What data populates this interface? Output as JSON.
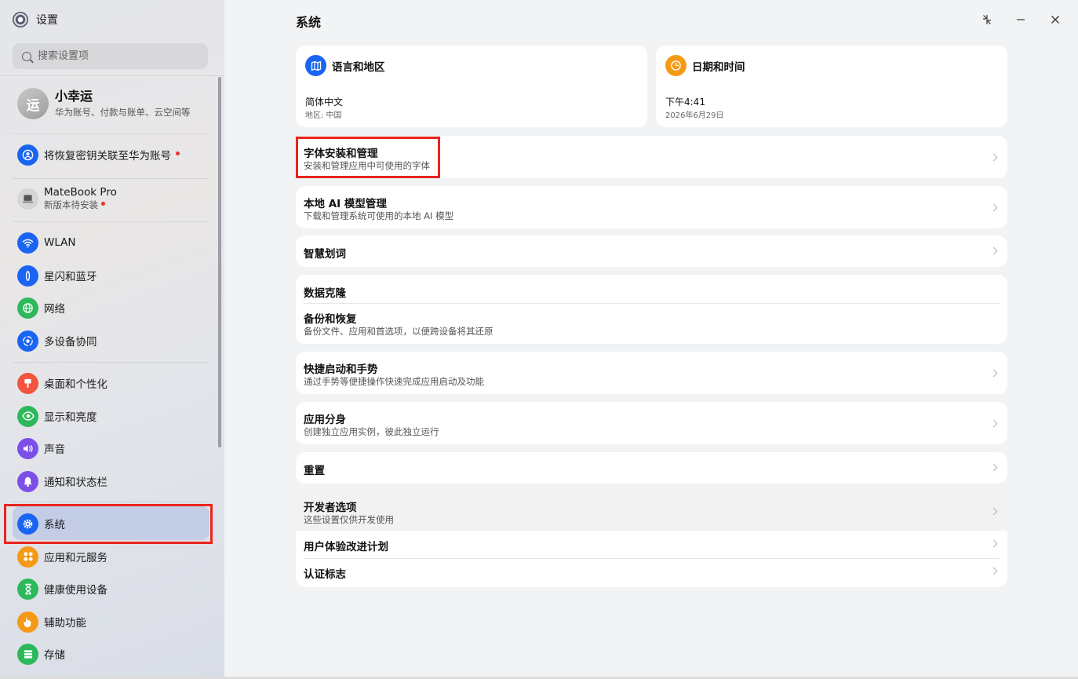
{
  "app": {
    "title": "设置"
  },
  "search": {
    "placeholder": "搜索设置项"
  },
  "account": {
    "avatar": "运",
    "name": "小幸运",
    "subtitle": "华为账号、付款与账单、云空间等"
  },
  "sidebar": {
    "recovery_key": "将恢复密钥关联至华为账号",
    "device": {
      "name": "MateBook Pro",
      "status": "新版本待安装"
    },
    "items": [
      {
        "label": "WLAN",
        "icon": "wifi-icon",
        "color": "#1a64f2"
      },
      {
        "label": "星闪和蓝牙",
        "icon": "bluetooth-icon",
        "color": "#1a64f2"
      },
      {
        "label": "网络",
        "icon": "globe-icon",
        "color": "#2eb85c"
      },
      {
        "label": "多设备协同",
        "icon": "multi-device-icon",
        "color": "#1a64f2"
      },
      {
        "label": "桌面和个性化",
        "icon": "brush-icon",
        "color": "#f2553d"
      },
      {
        "label": "显示和亮度",
        "icon": "eye-icon",
        "color": "#2eb85c"
      },
      {
        "label": "声音",
        "icon": "speaker-icon",
        "color": "#7b4fe8"
      },
      {
        "label": "通知和状态栏",
        "icon": "bell-icon",
        "color": "#7b4fe8"
      },
      {
        "label": "系统",
        "icon": "gear-icon",
        "color": "#1a64f2",
        "selected": true
      },
      {
        "label": "应用和元服务",
        "icon": "apps-icon",
        "color": "#f59a16"
      },
      {
        "label": "健康使用设备",
        "icon": "hourglass-icon",
        "color": "#2eb85c"
      },
      {
        "label": "辅助功能",
        "icon": "hand-icon",
        "color": "#f59a16"
      },
      {
        "label": "存储",
        "icon": "storage-icon",
        "color": "#2eb85c"
      }
    ]
  },
  "main": {
    "title": "系统",
    "language_card": {
      "title": "语言和地区",
      "value": "简体中文",
      "sub": "地区: 中国",
      "icon_color": "#1a64f2"
    },
    "datetime_card": {
      "title": "日期和时间",
      "value": "下午4:41",
      "sub": "2026年6月29日",
      "icon_color": "#f59a16"
    },
    "rows": {
      "font": {
        "title": "字体安装和管理",
        "desc": "安装和管理应用中可使用的字体"
      },
      "ai": {
        "title": "本地 AI 模型管理",
        "desc": "下载和管理系统可使用的本地 AI 模型"
      },
      "smart_word": {
        "title": "智慧划词"
      },
      "clone": {
        "title": "数据克隆"
      },
      "backup": {
        "title": "备份和恢复",
        "desc": "备份文件、应用和首选项，以便跨设备将其还原"
      },
      "gesture": {
        "title": "快捷启动和手势",
        "desc": "通过手势等便捷操作快速完成应用启动及功能"
      },
      "app_twin": {
        "title": "应用分身",
        "desc": "创建独立应用实例，彼此独立运行"
      },
      "reset": {
        "title": "重置"
      },
      "developer": {
        "title": "开发者选项",
        "desc": "这些设置仅供开发使用"
      },
      "ux_plan": {
        "title": "用户体验改进计划"
      },
      "cert": {
        "title": "认证标志"
      }
    }
  }
}
